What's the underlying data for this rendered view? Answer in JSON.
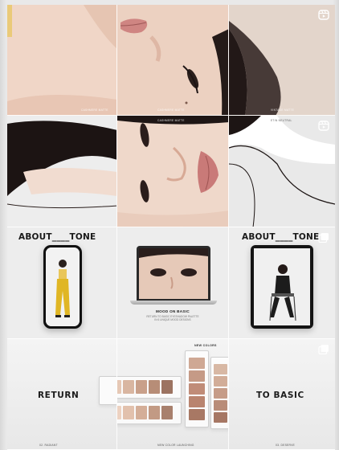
{
  "grid": {
    "row1": {
      "caption_a": "CASHMERE MATTE",
      "caption_b": "VINTAGE MATTE",
      "caption_c": "CASHMERE MATTE",
      "caption_d": "ETIN NEUTRAL"
    },
    "row3": {
      "about_left": "ABOUT____TONE",
      "about_right": "ABOUT____TONE",
      "laptop_title": "MOOD ON BASIC",
      "laptop_sub_1": "RETURN TO BASIC EYESHADOW PALETTE",
      "laptop_sub_2": "IN 6 UNIQUE MOOD DESIGNS"
    },
    "row4": {
      "left_word": "RETURN",
      "right_word": "TO BASIC",
      "top_tag": "NEW COLORS",
      "cap_left": "02. RADIANT",
      "cap_mid": "NEW COLOR LAUNCHING",
      "cap_right": "03. DESERVE"
    }
  },
  "icons": {
    "reel": "reels-icon",
    "multi": "carousel-icon"
  },
  "colors": {
    "skin": "#ecd0bf",
    "lip": "#c97a78",
    "hair": "#1b1414",
    "background": "#e9e9e9"
  }
}
